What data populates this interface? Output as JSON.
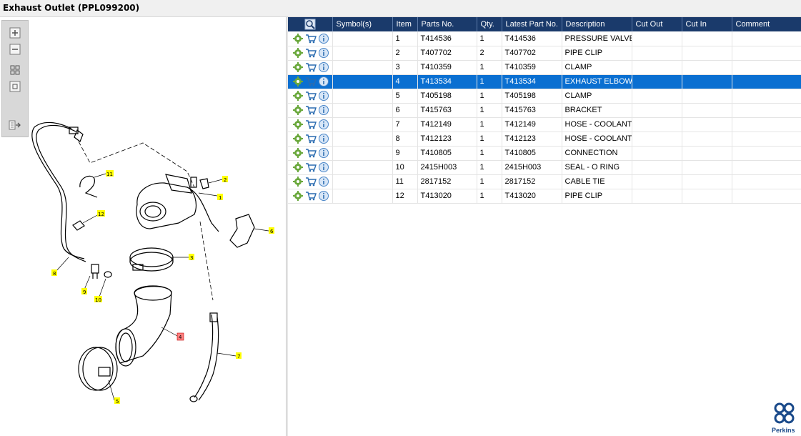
{
  "window": {
    "title": "Exhaust Outlet (PPL099200)"
  },
  "viewer": {
    "toolbar": [
      "zoom-in",
      "zoom-out",
      "fit-all",
      "fit-window",
      "export"
    ],
    "callouts": [
      {
        "id": "1",
        "label": "1",
        "highlighted": false
      },
      {
        "id": "2",
        "label": "2",
        "highlighted": false
      },
      {
        "id": "3",
        "label": "3",
        "highlighted": false
      },
      {
        "id": "4",
        "label": "4",
        "highlighted": true
      },
      {
        "id": "5",
        "label": "5",
        "highlighted": false
      },
      {
        "id": "6",
        "label": "6",
        "highlighted": false
      },
      {
        "id": "7",
        "label": "7",
        "highlighted": false
      },
      {
        "id": "8",
        "label": "8",
        "highlighted": false
      },
      {
        "id": "9",
        "label": "9",
        "highlighted": false
      },
      {
        "id": "10",
        "label": "10",
        "highlighted": false
      },
      {
        "id": "11",
        "label": "11",
        "highlighted": false
      },
      {
        "id": "12",
        "label": "12",
        "highlighted": false
      }
    ]
  },
  "table": {
    "headers": [
      "",
      "Symbol(s)",
      "Item",
      "Parts No.",
      "Qty.",
      "Latest Part No.",
      "Description",
      "Cut Out",
      "Cut In",
      "Comment"
    ],
    "rows": [
      {
        "symbols": "",
        "item": "1",
        "part": "T414536",
        "qty": "1",
        "latest": "T414536",
        "desc": "PRESSURE VALVE",
        "cut_out": "",
        "cut_in": "",
        "comment": ""
      },
      {
        "symbols": "",
        "item": "2",
        "part": "T407702",
        "qty": "2",
        "latest": "T407702",
        "desc": "PIPE CLIP",
        "cut_out": "",
        "cut_in": "",
        "comment": ""
      },
      {
        "symbols": "",
        "item": "3",
        "part": "T410359",
        "qty": "1",
        "latest": "T410359",
        "desc": "CLAMP",
        "cut_out": "",
        "cut_in": "",
        "comment": ""
      },
      {
        "symbols": "",
        "item": "4",
        "part": "T413534",
        "qty": "1",
        "latest": "T413534",
        "desc": "EXHAUST ELBOW",
        "cut_out": "",
        "cut_in": "",
        "comment": "",
        "selected": true
      },
      {
        "symbols": "",
        "item": "5",
        "part": "T405198",
        "qty": "1",
        "latest": "T405198",
        "desc": "CLAMP",
        "cut_out": "",
        "cut_in": "",
        "comment": ""
      },
      {
        "symbols": "",
        "item": "6",
        "part": "T415763",
        "qty": "1",
        "latest": "T415763",
        "desc": "BRACKET",
        "cut_out": "",
        "cut_in": "",
        "comment": ""
      },
      {
        "symbols": "",
        "item": "7",
        "part": "T412149",
        "qty": "1",
        "latest": "T412149",
        "desc": "HOSE - COOLANT",
        "cut_out": "",
        "cut_in": "",
        "comment": ""
      },
      {
        "symbols": "",
        "item": "8",
        "part": "T412123",
        "qty": "1",
        "latest": "T412123",
        "desc": "HOSE - COOLANT",
        "cut_out": "",
        "cut_in": "",
        "comment": ""
      },
      {
        "symbols": "",
        "item": "9",
        "part": "T410805",
        "qty": "1",
        "latest": "T410805",
        "desc": "CONNECTION",
        "cut_out": "",
        "cut_in": "",
        "comment": ""
      },
      {
        "symbols": "",
        "item": "10",
        "part": "2415H003",
        "qty": "1",
        "latest": "2415H003",
        "desc": "SEAL - O RING",
        "cut_out": "",
        "cut_in": "",
        "comment": ""
      },
      {
        "symbols": "",
        "item": "11",
        "part": "2817152",
        "qty": "1",
        "latest": "2817152",
        "desc": "CABLE TIE",
        "cut_out": "",
        "cut_in": "",
        "comment": ""
      },
      {
        "symbols": "",
        "item": "12",
        "part": "T413020",
        "qty": "1",
        "latest": "T413020",
        "desc": "PIPE CLIP",
        "cut_out": "",
        "cut_in": "",
        "comment": ""
      }
    ],
    "row_icons": [
      "gear-icon",
      "cart-icon",
      "info-icon"
    ],
    "header_icon": "find-in-drawing-icon"
  },
  "brand": {
    "name": "Perkins",
    "color": "#1a4a8a"
  },
  "colors": {
    "header_bg": "#1a3a6b",
    "selected_bg": "#0a6fd1",
    "callout_bg": "#ffff00",
    "callout_highlight": "#ff8080"
  }
}
